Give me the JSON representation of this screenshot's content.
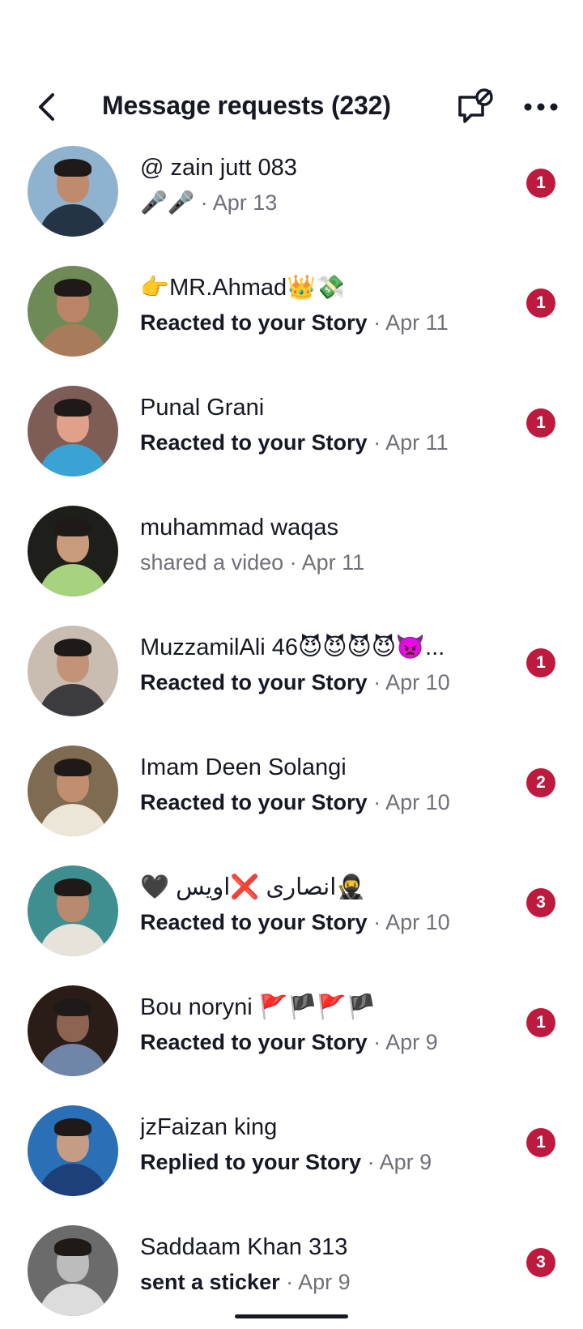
{
  "header": {
    "title": "Message requests (232)",
    "back_icon": "chevron-left-icon",
    "mute_icon": "message-off-icon",
    "more_icon": "more-horizontal-icon"
  },
  "requests": [
    {
      "name": "@ zain jutt  083",
      "action": "🎤🎤",
      "date": "· Apr 13",
      "badge": "1",
      "unread": true,
      "skin": "#c08a6c",
      "bg": "#8fb2cf",
      "shirt": "#243445"
    },
    {
      "name": "👉MR.Ahmad👑💸",
      "action": "Reacted to your Story",
      "date": "· Apr 11",
      "badge": "1",
      "unread": true,
      "skin": "#b98468",
      "bg": "#6e8a56",
      "shirt": "#a87c5a"
    },
    {
      "name": "Punal Grani",
      "action": "Reacted to your Story",
      "date": "· Apr 11",
      "badge": "1",
      "unread": true,
      "skin": "#e1a089",
      "bg": "#7d5d56",
      "shirt": "#3aa3d6"
    },
    {
      "name": "muhammad waqas",
      "action": "shared a video",
      "date": "· Apr 11",
      "badge": "",
      "unread": false,
      "skin": "#c79b7c",
      "bg": "#1e1f1a",
      "shirt": "#a8d37e"
    },
    {
      "name": "MuzzamilAli 46😈😈😈😈👿...",
      "action": "Reacted to your Story",
      "date": "· Apr 10",
      "badge": "1",
      "unread": true,
      "skin": "#c39378",
      "bg": "#c9bcb0",
      "shirt": "#3b3b40"
    },
    {
      "name": "Imam Deen Solangi",
      "action": "Reacted to your Story",
      "date": "· Apr 10",
      "badge": "2",
      "unread": true,
      "skin": "#c08f70",
      "bg": "#7f6a52",
      "shirt": "#ece6d8"
    },
    {
      "name": "🖤 انصاری ❌اویس🥷",
      "action": "Reacted to your Story",
      "date": "· Apr 10",
      "badge": "3",
      "unread": true,
      "skin": "#b98a6f",
      "bg": "#3f8f90",
      "shirt": "#e7e2da"
    },
    {
      "name": "Bou noryni 🚩🏴🚩🏴",
      "action": "Reacted to your Story",
      "date": "· Apr 9",
      "badge": "1",
      "unread": true,
      "skin": "#8c6450",
      "bg": "#2a1d18",
      "shirt": "#6f86a8"
    },
    {
      "name": "jzFaizan king",
      "action": "Replied to your Story",
      "date": "· Apr 9",
      "badge": "1",
      "unread": true,
      "skin": "#c59c84",
      "bg": "#2b6fb7",
      "shirt": "#1d3f7a"
    },
    {
      "name": "Saddaam Khan 313",
      "action": "sent a sticker",
      "date": "· Apr 9",
      "badge": "3",
      "unread": true,
      "skin": "#bcbcbc",
      "bg": "#6b6b6b",
      "shirt": "#dcdcdc"
    }
  ]
}
